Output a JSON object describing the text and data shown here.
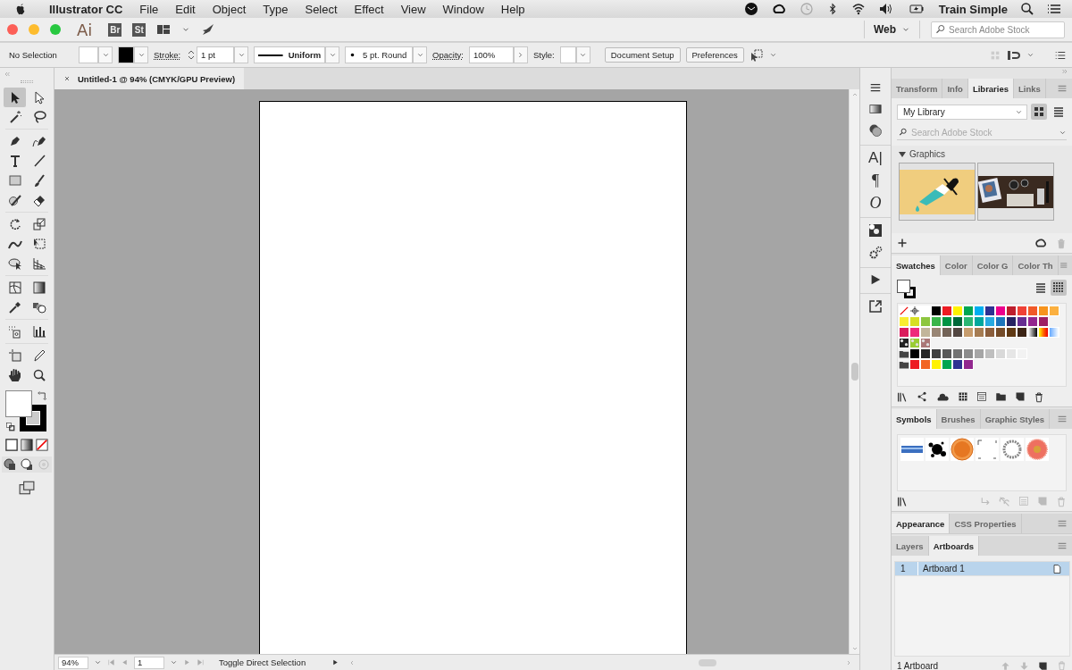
{
  "menu_bar": {
    "app_name": "Illustrator CC",
    "menus": [
      "File",
      "Edit",
      "Object",
      "Type",
      "Select",
      "Effect",
      "View",
      "Window",
      "Help"
    ],
    "user": "Train Simple"
  },
  "app_bar": {
    "logo": "Ai",
    "apps": [
      "Br",
      "St"
    ],
    "workspace": "Web",
    "search": {
      "placeholder": "Search Adobe Stock"
    }
  },
  "control_bar": {
    "selection": "No Selection",
    "stroke_label": "Stroke:",
    "stroke_weight": "1 pt",
    "profile": "Uniform",
    "brush": "5 pt. Round",
    "opacity_label": "Opacity:",
    "opacity": "100%",
    "style_label": "Style:",
    "buttons": [
      "Document Setup",
      "Preferences"
    ]
  },
  "tools": [
    {
      "selected": true
    },
    {
      "selected": false
    },
    {
      "selected": false
    },
    {
      "selected": false
    },
    {
      "selected": false
    },
    {
      "selected": false
    },
    {
      "selected": false
    },
    {
      "selected": false
    },
    {
      "selected": false
    },
    {
      "selected": false
    },
    {
      "selected": false
    },
    {
      "selected": false
    },
    {
      "selected": false
    },
    {
      "selected": false
    },
    {
      "selected": false
    },
    {
      "selected": false
    },
    {
      "selected": false
    },
    {
      "selected": false
    },
    {
      "selected": false
    },
    {
      "selected": false
    },
    {
      "selected": false
    },
    {
      "selected": false
    },
    {
      "selected": false
    },
    {
      "selected": false
    },
    {
      "selected": false
    },
    {
      "selected": false
    },
    {
      "selected": false
    },
    {
      "selected": false
    }
  ],
  "document": {
    "tab": "Untitled-1 @ 94% (CMYK/GPU Preview)",
    "status_bar": {
      "zoom": "94%",
      "artboard": "1",
      "status": "Toggle Direct Selection"
    }
  },
  "dock": {
    "type_glyphs": [
      "A|",
      "¶",
      "O"
    ]
  },
  "library_panel": {
    "tabs": [
      {
        "label": "Transform",
        "selected": false
      },
      {
        "label": "Info",
        "selected": false
      },
      {
        "label": "Libraries",
        "selected": true
      },
      {
        "label": "Links",
        "selected": false
      }
    ],
    "library": "My Library",
    "view_toggles": [
      {
        "selected": true
      },
      {
        "selected": false
      }
    ],
    "search": {
      "placeholder": "Search Adobe Stock"
    },
    "section": {
      "label": "Graphics",
      "expanded": true
    },
    "graphics": [
      {
        "kind": "drawing"
      },
      {
        "kind": "picture"
      }
    ]
  },
  "swatches_panel": {
    "tabs": [
      {
        "label": "Swatches",
        "selected": true
      },
      {
        "label": "Color",
        "selected": false
      },
      {
        "label": "Color G",
        "selected": false
      },
      {
        "label": "Color Th",
        "selected": false
      }
    ],
    "view_toggles": [
      {
        "selected": false
      },
      {
        "selected": true
      }
    ],
    "groups": [
      {
        "kind": "plain",
        "swatches": [
          {
            "kind": "none"
          },
          {
            "kind": "registration"
          },
          {
            "kind": "solid",
            "color": "#ffffff"
          },
          {
            "kind": "solid",
            "color": "#000000"
          },
          {
            "kind": "solid",
            "color": "#ed1c24"
          },
          {
            "kind": "solid",
            "color": "#fff200"
          },
          {
            "kind": "solid",
            "color": "#00a651"
          },
          {
            "kind": "solid",
            "color": "#00aeef"
          },
          {
            "kind": "solid",
            "color": "#2e3192"
          },
          {
            "kind": "solid",
            "color": "#ec008c"
          },
          {
            "kind": "solid",
            "color": "#be1e2d"
          },
          {
            "kind": "solid",
            "color": "#ef4136"
          },
          {
            "kind": "solid",
            "color": "#f15a29"
          },
          {
            "kind": "solid",
            "color": "#f7941d"
          },
          {
            "kind": "solid",
            "color": "#fbb040"
          }
        ]
      },
      {
        "kind": "plain",
        "swatches": [
          {
            "kind": "solid",
            "color": "#f9ed32"
          },
          {
            "kind": "solid",
            "color": "#d7df23"
          },
          {
            "kind": "solid",
            "color": "#8dc63f"
          },
          {
            "kind": "solid",
            "color": "#39b54a"
          },
          {
            "kind": "solid",
            "color": "#009444"
          },
          {
            "kind": "solid",
            "color": "#006838"
          },
          {
            "kind": "solid",
            "color": "#2bb673"
          },
          {
            "kind": "solid",
            "color": "#00a79d"
          },
          {
            "kind": "solid",
            "color": "#27aae1"
          },
          {
            "kind": "solid",
            "color": "#1c75bc"
          },
          {
            "kind": "solid",
            "color": "#262262"
          },
          {
            "kind": "solid",
            "color": "#662d91"
          },
          {
            "kind": "solid",
            "color": "#92278f"
          },
          {
            "kind": "solid",
            "color": "#9e1f63"
          }
        ]
      },
      {
        "kind": "plain",
        "swatches": [
          {
            "kind": "solid",
            "color": "#da1c5c"
          },
          {
            "kind": "solid",
            "color": "#ee2a7b"
          },
          {
            "kind": "solid",
            "color": "#c2b59b"
          },
          {
            "kind": "solid",
            "color": "#998675"
          },
          {
            "kind": "solid",
            "color": "#736357"
          },
          {
            "kind": "solid",
            "color": "#534741"
          },
          {
            "kind": "solid",
            "color": "#c69c6d"
          },
          {
            "kind": "solid",
            "color": "#a67c52"
          },
          {
            "kind": "solid",
            "color": "#8b5e3c"
          },
          {
            "kind": "solid",
            "color": "#754c29"
          },
          {
            "kind": "solid",
            "color": "#603913"
          },
          {
            "kind": "solid",
            "color": "#3c2415"
          },
          {
            "kind": "gradient"
          },
          {
            "kind": "gradient"
          },
          {
            "kind": "gradient"
          }
        ]
      },
      {
        "kind": "plain",
        "swatches": [
          {
            "kind": "pattern"
          },
          {
            "kind": "pattern"
          },
          {
            "kind": "pattern"
          }
        ]
      },
      {
        "kind": "folder",
        "swatches": [
          {
            "kind": "solid",
            "color": "#000000"
          },
          {
            "kind": "solid",
            "color": "#262626"
          },
          {
            "kind": "solid",
            "color": "#404040"
          },
          {
            "kind": "solid",
            "color": "#595959"
          },
          {
            "kind": "solid",
            "color": "#737373"
          },
          {
            "kind": "solid",
            "color": "#8c8c8c"
          },
          {
            "kind": "solid",
            "color": "#a6a6a6"
          },
          {
            "kind": "solid",
            "color": "#bfbfbf"
          },
          {
            "kind": "solid",
            "color": "#d9d9d9"
          },
          {
            "kind": "solid",
            "color": "#e6e6e6"
          },
          {
            "kind": "solid",
            "color": "#f2f2f2"
          }
        ]
      },
      {
        "kind": "folder",
        "swatches": [
          {
            "kind": "solid",
            "color": "#ed1c24"
          },
          {
            "kind": "solid",
            "color": "#f26522"
          },
          {
            "kind": "solid",
            "color": "#fff200"
          },
          {
            "kind": "solid",
            "color": "#00a651"
          },
          {
            "kind": "solid",
            "color": "#2e3192"
          },
          {
            "kind": "solid",
            "color": "#92278f"
          }
        ]
      }
    ]
  },
  "symbols_panel": {
    "tabs": [
      {
        "label": "Symbols",
        "selected": true
      },
      {
        "label": "Brushes",
        "selected": false
      },
      {
        "label": "Graphic Styles",
        "selected": false
      }
    ]
  },
  "appearance_panel": {
    "tabs": [
      {
        "label": "Appearance",
        "selected": true
      },
      {
        "label": "CSS Properties",
        "selected": false
      }
    ]
  },
  "artboards_panel": {
    "tabs": [
      {
        "label": "Layers",
        "selected": false
      },
      {
        "label": "Artboards",
        "selected": true
      }
    ],
    "rows": [
      {
        "number": "1",
        "name": "Artboard 1",
        "selected": true
      }
    ],
    "footer": "1 Artboard"
  }
}
